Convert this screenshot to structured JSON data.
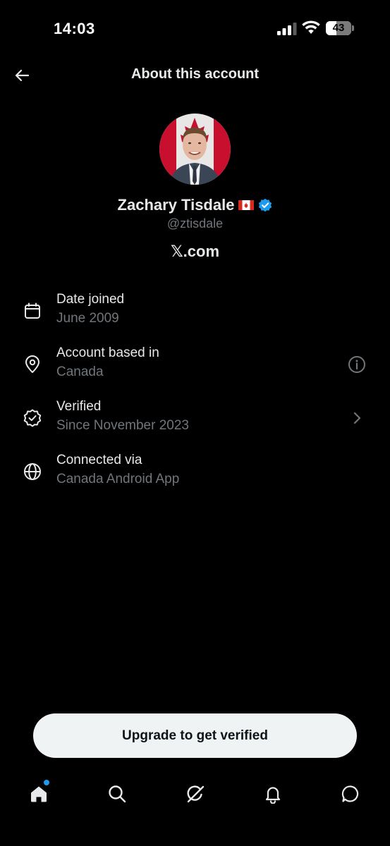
{
  "status_bar": {
    "time": "14:03",
    "battery": "43",
    "battery_fraction": 0.43
  },
  "header": {
    "title": "About this account",
    "back_icon": "arrow-left-icon"
  },
  "profile": {
    "name": "Zachary Tisdale",
    "flag_icon": "canada-flag-icon",
    "verified_icon": "verified-badge-icon",
    "handle": "@ztisdale",
    "site": "𝕏.com"
  },
  "info": [
    {
      "icon": "calendar-icon",
      "title": "Date joined",
      "subtitle": "June 2009"
    },
    {
      "icon": "location-pin-icon",
      "title": "Account based in",
      "subtitle": "Canada",
      "trailing": "info-icon"
    },
    {
      "icon": "verified-outline-icon",
      "title": "Verified",
      "subtitle": "Since November 2023",
      "trailing": "chevron-right-icon"
    },
    {
      "icon": "globe-icon",
      "title": "Connected via",
      "subtitle": "Canada Android App"
    }
  ],
  "upgrade_label": "Upgrade to get verified",
  "nav": [
    "home-icon",
    "search-icon",
    "grok-icon",
    "notifications-bell-icon",
    "messages-icon"
  ],
  "colors": {
    "background": "#000000",
    "text": "#e7e9ea",
    "secondary": "#71767b",
    "accent": "#1d9bf0",
    "button_bg": "#eff3f4"
  }
}
